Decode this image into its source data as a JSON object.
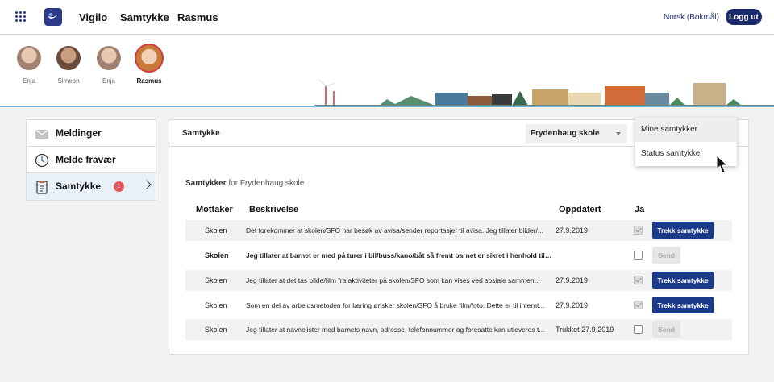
{
  "topbar": {
    "brand": "Vigilo",
    "nav": [
      "Samtykke",
      "Rasmus"
    ],
    "language": "Norsk (Bokmål)",
    "logout_label": "Logg ut",
    "accent_color": "#1c2a6e"
  },
  "children": [
    {
      "name": "Enja",
      "active": false
    },
    {
      "name": "Simeon",
      "active": false
    },
    {
      "name": "Enja",
      "active": false
    },
    {
      "name": "Rasmus",
      "active": true
    }
  ],
  "sidebar": {
    "items": [
      {
        "label": "Meldinger",
        "icon": "envelope-icon"
      },
      {
        "label": "Melde fravær",
        "icon": "clock-icon"
      },
      {
        "label": "Samtykke",
        "icon": "clipboard-icon",
        "badge": "1",
        "active": true
      }
    ]
  },
  "panel": {
    "title": "Samtykke",
    "school_select": "Frydenhaug skole",
    "subtitle_bold": "Samtykker",
    "subtitle_rest": " for Frydenhaug skole",
    "columns": [
      "Mottaker",
      "Beskrivelse",
      "Oppdatert",
      "Ja"
    ],
    "rows": [
      {
        "recipient": "Skolen",
        "description": "Det forekommer at skolen/SFO har besøk av avisa/sender reportasjer til avisa. Jeg tillater bilder/...",
        "updated": "27.9.2019",
        "checked": true,
        "button": "Trekk samtykke",
        "button_enabled": true,
        "bold": false
      },
      {
        "recipient": "Skolen",
        "description": "Jeg tillater at barnet er med på turer i bil/buss/kano/båt så fremt barnet er sikret i henhold til gj...",
        "updated": "",
        "checked": false,
        "button": "Send",
        "button_enabled": false,
        "bold": true
      },
      {
        "recipient": "Skolen",
        "description": " Jeg tillater at det tas bilde/film fra aktiviteter på skolen/SFO som kan vises ved sosiale sammen...",
        "updated": "27.9.2019",
        "checked": true,
        "button": "Trekk samtykke",
        "button_enabled": true,
        "bold": false
      },
      {
        "recipient": "Skolen",
        "description": "Som en del av arbeidsmetoden for læring ønsker skolen/SFO å bruke film/foto. Dette er til internt...",
        "updated": "27.9.2019",
        "checked": true,
        "button": "Trekk samtykke",
        "button_enabled": true,
        "bold": false
      },
      {
        "recipient": "Skolen",
        "description": "Jeg tillater at navnelister med barnets navn, adresse, telefonnummer og foresatte kan utleveres t...",
        "updated": "Trukket 27.9.2019",
        "checked": false,
        "button": "Send",
        "button_enabled": false,
        "bold": false
      }
    ]
  },
  "menu": {
    "items": [
      "Mine samtykker",
      "Status samtykker"
    ]
  }
}
